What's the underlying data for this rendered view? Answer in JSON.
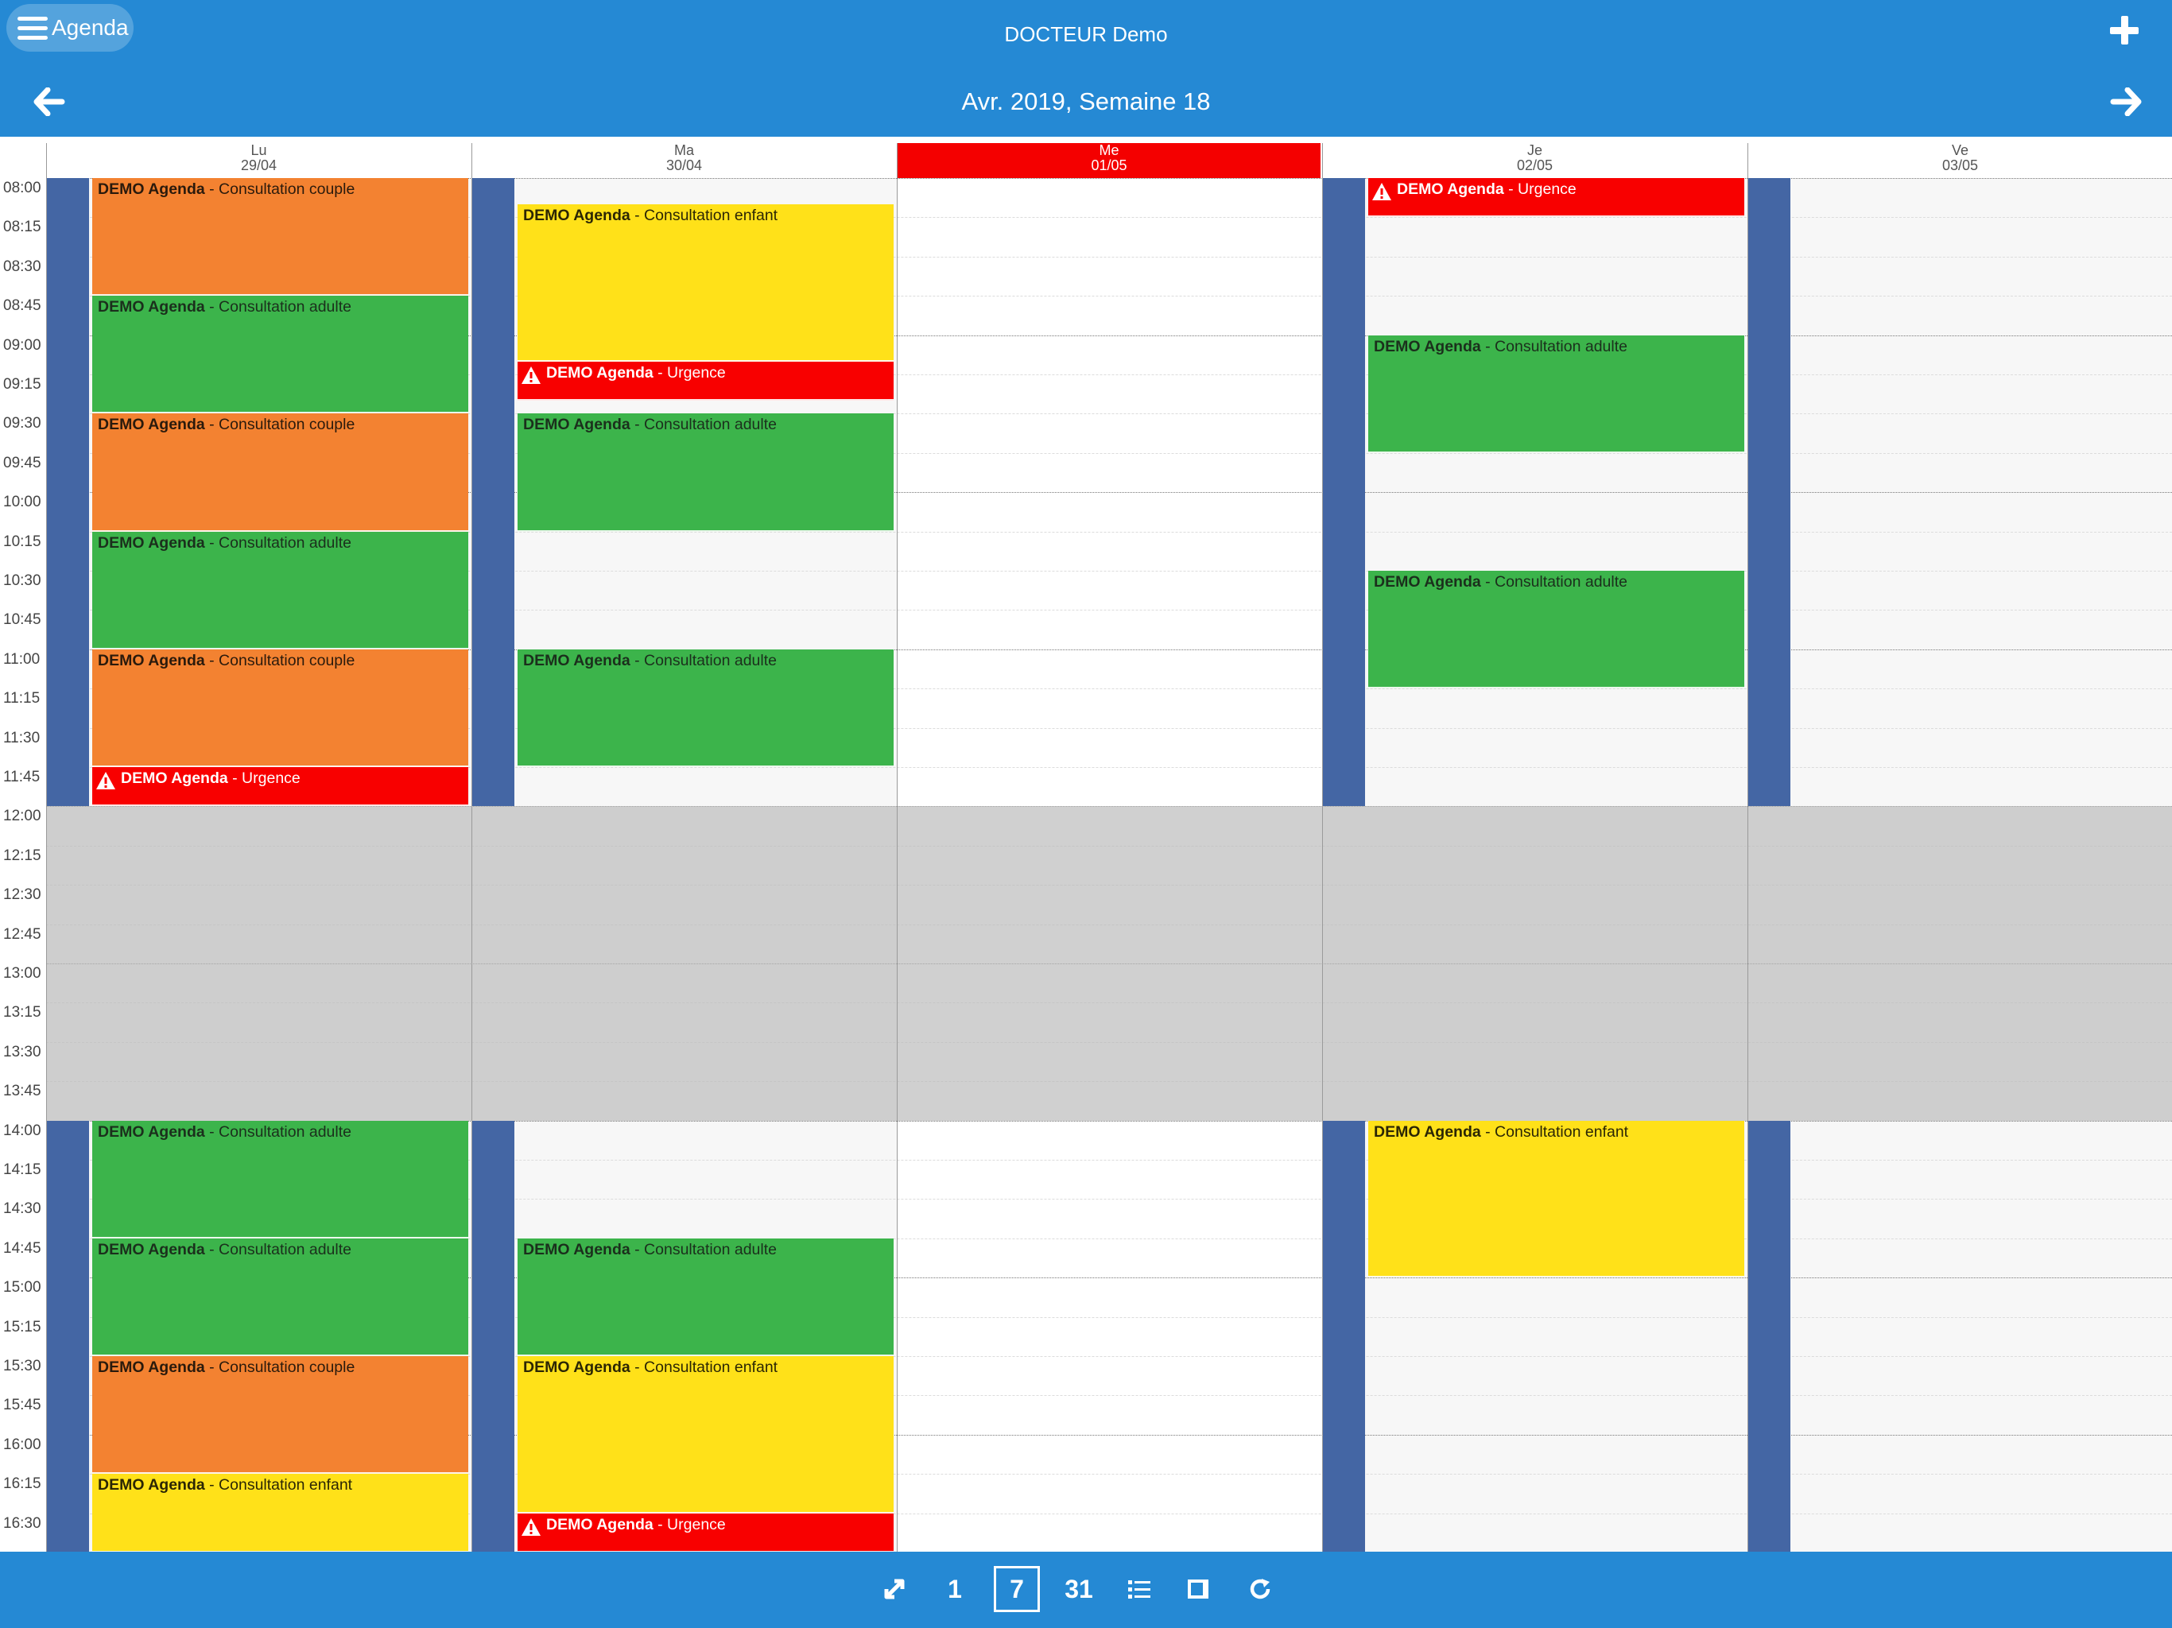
{
  "header": {
    "menu_label": "Agenda",
    "doctor": "DOCTEUR Demo",
    "week_title": "Avr. 2019, Semaine 18"
  },
  "days": [
    {
      "abbr": "Lu",
      "date": "29/04",
      "today": false
    },
    {
      "abbr": "Ma",
      "date": "30/04",
      "today": false
    },
    {
      "abbr": "Me",
      "date": "01/05",
      "today": true
    },
    {
      "abbr": "Je",
      "date": "02/05",
      "today": false
    },
    {
      "abbr": "Ve",
      "date": "03/05",
      "today": false
    }
  ],
  "times": [
    "08:00",
    "08:15",
    "08:30",
    "08:45",
    "09:00",
    "09:15",
    "09:30",
    "09:45",
    "10:00",
    "10:15",
    "10:30",
    "10:45",
    "11:00",
    "11:15",
    "11:30",
    "11:45",
    "12:00",
    "12:15",
    "12:30",
    "12:45",
    "13:00",
    "13:15",
    "13:30",
    "13:45",
    "14:00",
    "14:15",
    "14:30",
    "14:45",
    "15:00",
    "15:15",
    "15:30",
    "15:45",
    "16:00",
    "16:15",
    "16:30"
  ],
  "lunch_break": {
    "start": "12:00",
    "end": "14:00"
  },
  "availability": [
    {
      "day": 0,
      "blocks": [
        [
          "08:00",
          "12:00"
        ],
        [
          "14:00",
          "16:45"
        ]
      ]
    },
    {
      "day": 1,
      "blocks": [
        [
          "08:00",
          "12:00"
        ],
        [
          "14:00",
          "16:45"
        ]
      ]
    },
    {
      "day": 3,
      "blocks": [
        [
          "08:00",
          "12:00"
        ],
        [
          "14:00",
          "16:45"
        ]
      ]
    },
    {
      "day": 4,
      "blocks": [
        [
          "08:00",
          "12:00"
        ],
        [
          "14:00",
          "16:45"
        ]
      ]
    }
  ],
  "events": [
    {
      "day": 0,
      "start": "08:00",
      "end": "08:45",
      "title": "DEMO Agenda",
      "type": "Consultation couple",
      "color": "orange"
    },
    {
      "day": 0,
      "start": "08:45",
      "end": "09:30",
      "title": "DEMO Agenda",
      "type": "Consultation adulte",
      "color": "green"
    },
    {
      "day": 0,
      "start": "09:30",
      "end": "10:15",
      "title": "DEMO Agenda",
      "type": "Consultation couple",
      "color": "orange"
    },
    {
      "day": 0,
      "start": "10:15",
      "end": "11:00",
      "title": "DEMO Agenda",
      "type": "Consultation adulte",
      "color": "green"
    },
    {
      "day": 0,
      "start": "11:00",
      "end": "11:45",
      "title": "DEMO Agenda",
      "type": "Consultation couple",
      "color": "orange"
    },
    {
      "day": 0,
      "start": "11:45",
      "end": "12:00",
      "title": "DEMO Agenda",
      "type": "Urgence",
      "color": "red"
    },
    {
      "day": 0,
      "start": "14:00",
      "end": "14:45",
      "title": "DEMO Agenda",
      "type": "Consultation adulte",
      "color": "green"
    },
    {
      "day": 0,
      "start": "14:45",
      "end": "15:30",
      "title": "DEMO Agenda",
      "type": "Consultation adulte",
      "color": "green"
    },
    {
      "day": 0,
      "start": "15:30",
      "end": "16:15",
      "title": "DEMO Agenda",
      "type": "Consultation couple",
      "color": "orange"
    },
    {
      "day": 0,
      "start": "16:15",
      "end": "16:45",
      "title": "DEMO Agenda",
      "type": "Consultation enfant",
      "color": "yellow"
    },
    {
      "day": 1,
      "start": "08:10",
      "end": "09:10",
      "title": "DEMO Agenda",
      "type": "Consultation enfant",
      "color": "yellow"
    },
    {
      "day": 1,
      "start": "09:10",
      "end": "09:25",
      "title": "DEMO Agenda",
      "type": "Urgence",
      "color": "red"
    },
    {
      "day": 1,
      "start": "09:30",
      "end": "10:15",
      "title": "DEMO Agenda",
      "type": "Consultation adulte",
      "color": "green"
    },
    {
      "day": 1,
      "start": "11:00",
      "end": "11:45",
      "title": "DEMO Agenda",
      "type": "Consultation adulte",
      "color": "green"
    },
    {
      "day": 1,
      "start": "14:45",
      "end": "15:30",
      "title": "DEMO Agenda",
      "type": "Consultation adulte",
      "color": "green"
    },
    {
      "day": 1,
      "start": "15:30",
      "end": "16:30",
      "title": "DEMO Agenda",
      "type": "Consultation enfant",
      "color": "yellow"
    },
    {
      "day": 1,
      "start": "16:30",
      "end": "16:45",
      "title": "DEMO Agenda",
      "type": "Urgence",
      "color": "red"
    },
    {
      "day": 3,
      "start": "08:00",
      "end": "08:15",
      "title": "DEMO Agenda",
      "type": "Urgence",
      "color": "red"
    },
    {
      "day": 3,
      "start": "09:00",
      "end": "09:45",
      "title": "DEMO Agenda",
      "type": "Consultation adulte",
      "color": "green"
    },
    {
      "day": 3,
      "start": "10:30",
      "end": "11:15",
      "title": "DEMO Agenda",
      "type": "Consultation adulte",
      "color": "green"
    },
    {
      "day": 3,
      "start": "14:00",
      "end": "15:00",
      "title": "DEMO Agenda",
      "type": "Consultation enfant",
      "color": "yellow"
    }
  ],
  "toolbar": {
    "items": [
      {
        "id": "fullscreen",
        "label": "",
        "icon": "expand-icon",
        "active": false
      },
      {
        "id": "day",
        "label": "1",
        "icon": "",
        "active": false
      },
      {
        "id": "week",
        "label": "7",
        "icon": "",
        "active": true
      },
      {
        "id": "month",
        "label": "31",
        "icon": "",
        "active": false
      },
      {
        "id": "list",
        "label": "",
        "icon": "list-icon",
        "active": false
      },
      {
        "id": "panel",
        "label": "",
        "icon": "panel-icon",
        "active": false
      },
      {
        "id": "refresh",
        "label": "",
        "icon": "refresh-icon",
        "active": false
      }
    ]
  }
}
